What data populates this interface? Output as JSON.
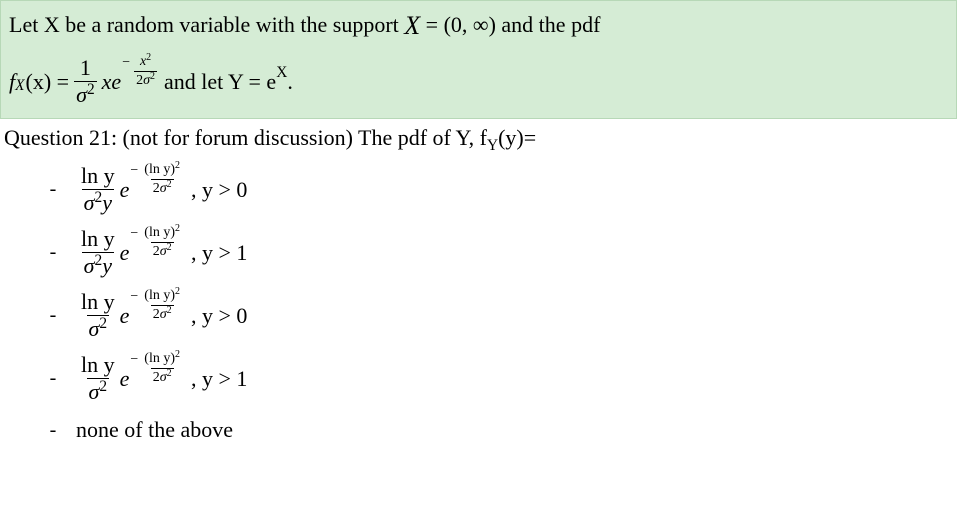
{
  "greenbox": {
    "intro_a": "Let X be a random variable with the support ",
    "support": " = (0, ∞)",
    "intro_b": " and the pdf",
    "fX_label_f": "f",
    "fX_label_sub": "X",
    "fX_label_arg": "(x) =",
    "frac1_num": "1",
    "sigma": "σ",
    "two": "2",
    "xe": "xe",
    "minus": "−",
    "x": "x",
    "and_let": " and let Y = e",
    "Xup": "X",
    "period": "."
  },
  "question": {
    "text": "Question 21: (not for forum discussion) The pdf of Y, f",
    "sub": "Y",
    "tail": "(y)="
  },
  "opts": {
    "ln_y": "ln y",
    "sigma": "σ",
    "two": "2",
    "y": "y",
    "e": "e",
    "minus": "−",
    "lnysq": "(ln y)",
    "gt0": ", y > 0",
    "gt1": ", y > 1",
    "none": "none of the above"
  }
}
